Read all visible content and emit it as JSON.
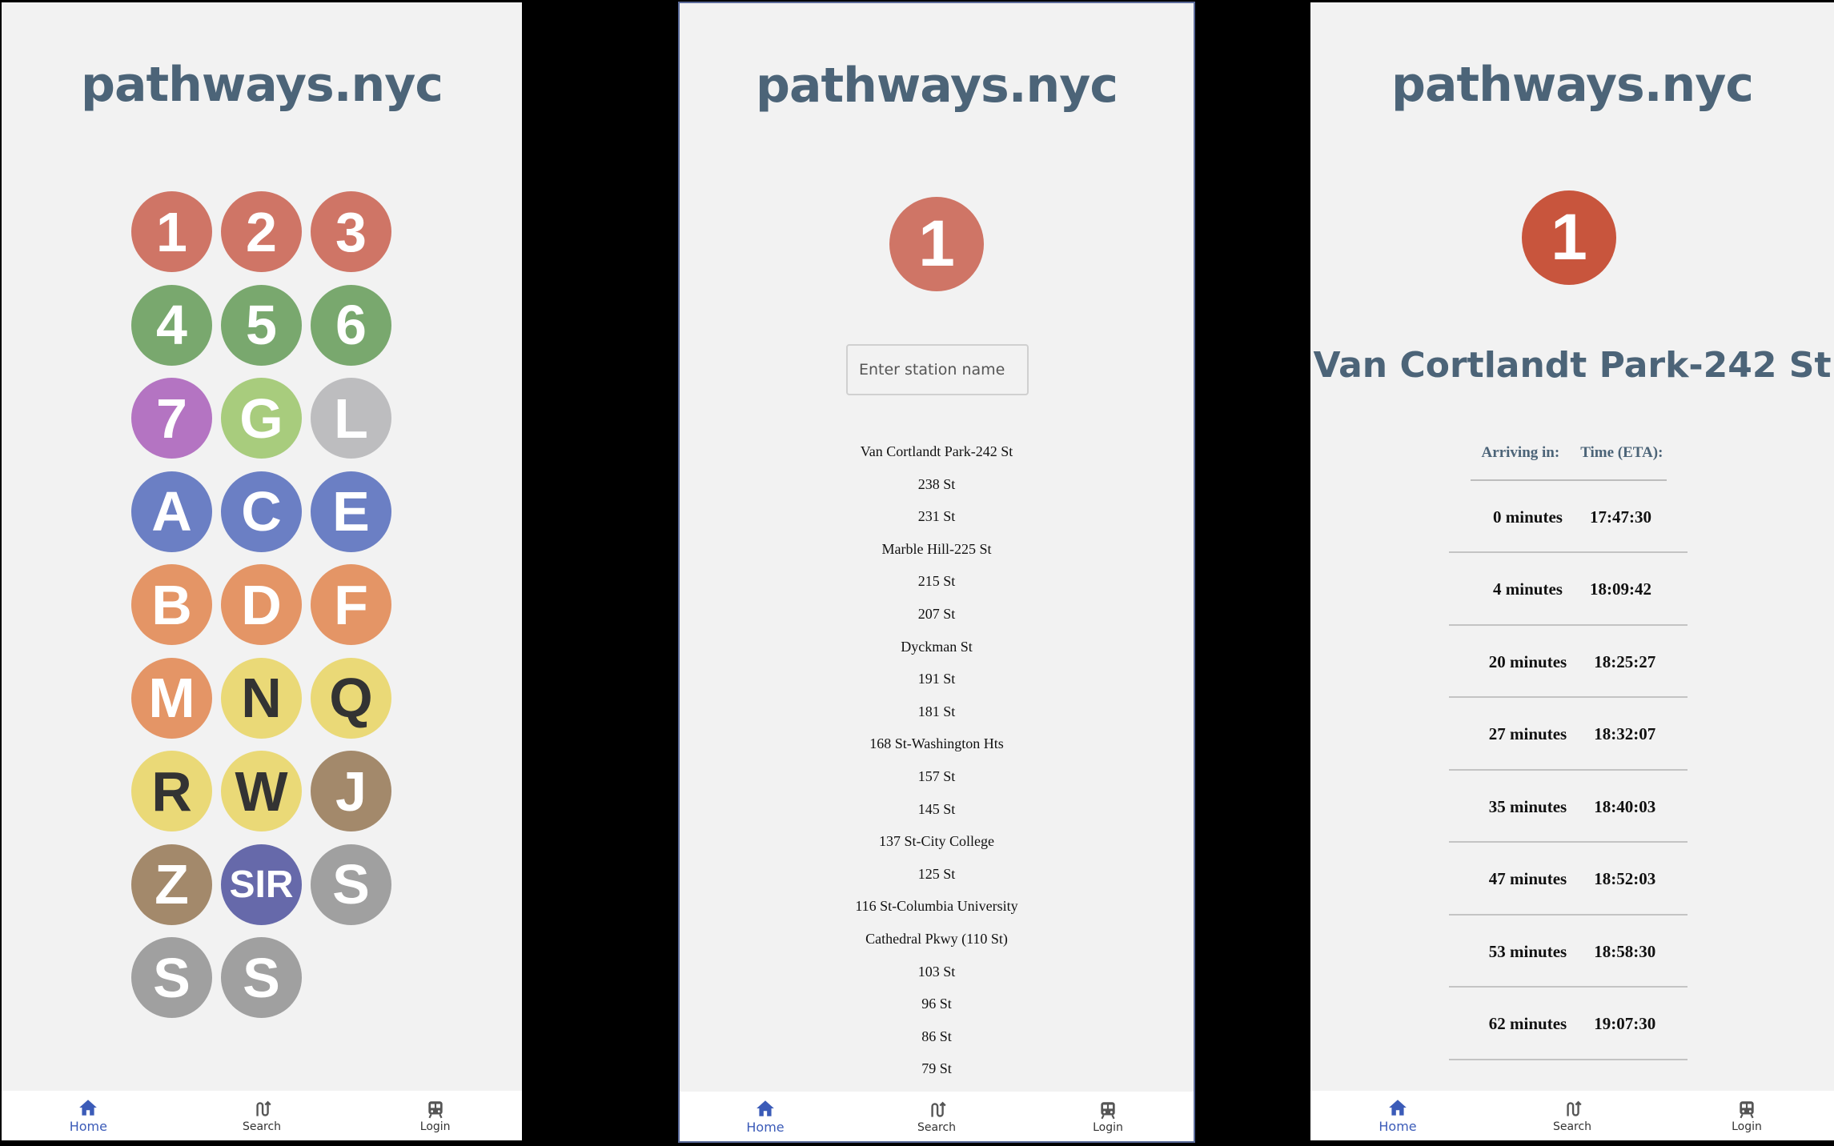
{
  "app_title": "pathways.nyc",
  "lines": [
    {
      "label": "1",
      "bg": "#cf7566",
      "fg": "#ffffff"
    },
    {
      "label": "2",
      "bg": "#cf7566",
      "fg": "#ffffff"
    },
    {
      "label": "3",
      "bg": "#cf7566",
      "fg": "#ffffff"
    },
    {
      "label": "4",
      "bg": "#79a86e",
      "fg": "#ffffff"
    },
    {
      "label": "5",
      "bg": "#79a86e",
      "fg": "#ffffff"
    },
    {
      "label": "6",
      "bg": "#79a86e",
      "fg": "#ffffff"
    },
    {
      "label": "7",
      "bg": "#b474c2",
      "fg": "#ffffff"
    },
    {
      "label": "G",
      "bg": "#a8cc7d",
      "fg": "#ffffff"
    },
    {
      "label": "L",
      "bg": "#bdbdbf",
      "fg": "#ffffff"
    },
    {
      "label": "A",
      "bg": "#6b7fc4",
      "fg": "#ffffff"
    },
    {
      "label": "C",
      "bg": "#6b7fc4",
      "fg": "#ffffff"
    },
    {
      "label": "E",
      "bg": "#6b7fc4",
      "fg": "#ffffff"
    },
    {
      "label": "B",
      "bg": "#e49566",
      "fg": "#ffffff"
    },
    {
      "label": "D",
      "bg": "#e49566",
      "fg": "#ffffff"
    },
    {
      "label": "F",
      "bg": "#e49566",
      "fg": "#ffffff"
    },
    {
      "label": "M",
      "bg": "#e49566",
      "fg": "#ffffff"
    },
    {
      "label": "N",
      "bg": "#ead977",
      "fg": "#333333"
    },
    {
      "label": "Q",
      "bg": "#ead977",
      "fg": "#333333"
    },
    {
      "label": "R",
      "bg": "#ead977",
      "fg": "#333333"
    },
    {
      "label": "W",
      "bg": "#ead977",
      "fg": "#333333"
    },
    {
      "label": "J",
      "bg": "#a3896b",
      "fg": "#ffffff"
    },
    {
      "label": "Z",
      "bg": "#a3896b",
      "fg": "#ffffff"
    },
    {
      "label": "SIR",
      "bg": "#6669aa",
      "fg": "#ffffff"
    },
    {
      "label": "S",
      "bg": "#a0a0a0",
      "fg": "#ffffff"
    },
    {
      "label": "S",
      "bg": "#a0a0a0",
      "fg": "#ffffff"
    },
    {
      "label": "S",
      "bg": "#a0a0a0",
      "fg": "#ffffff"
    }
  ],
  "selected_line": {
    "label": "1",
    "bg": "#cf7566",
    "bg_active": "#c8553d"
  },
  "search": {
    "placeholder": "Enter station name"
  },
  "stations": [
    "Van Cortlandt Park-242 St",
    "238 St",
    "231 St",
    "Marble Hill-225 St",
    "215 St",
    "207 St",
    "Dyckman St",
    "191 St",
    "181 St",
    "168 St-Washington Hts",
    "157 St",
    "145 St",
    "137 St-City College",
    "125 St",
    "116 St-Columbia University",
    "Cathedral Pkwy (110 St)",
    "103 St",
    "96 St",
    "86 St",
    "79 St"
  ],
  "station_detail": {
    "name": "Van Cortlandt Park-242 St",
    "header_arriving": "Arriving in:",
    "header_eta": "Time (ETA):",
    "arrivals": [
      {
        "minutes": "0 minutes",
        "eta": "17:47:30"
      },
      {
        "minutes": "4 minutes",
        "eta": "18:09:42"
      },
      {
        "minutes": "20 minutes",
        "eta": "18:25:27"
      },
      {
        "minutes": "27 minutes",
        "eta": "18:32:07"
      },
      {
        "minutes": "35 minutes",
        "eta": "18:40:03"
      },
      {
        "minutes": "47 minutes",
        "eta": "18:52:03"
      },
      {
        "minutes": "53 minutes",
        "eta": "18:58:30"
      },
      {
        "minutes": "62 minutes",
        "eta": "19:07:30"
      }
    ]
  },
  "nav": {
    "home": "Home",
    "search": "Search",
    "login": "Login"
  },
  "colors": {
    "accent": "#3b5bb8",
    "title": "#4c6478"
  }
}
